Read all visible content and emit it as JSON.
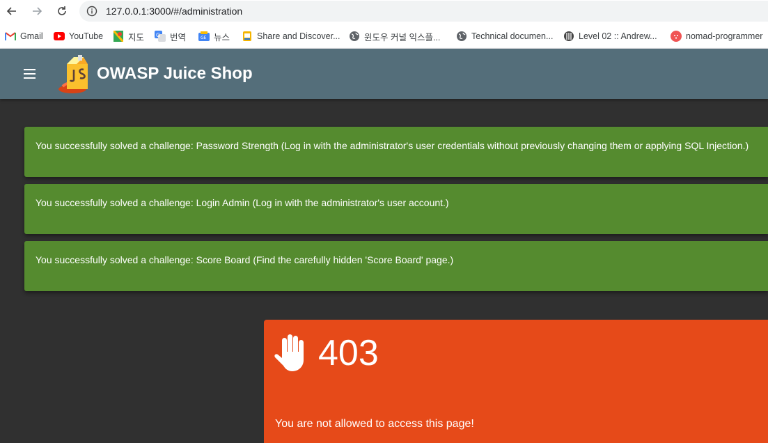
{
  "browser": {
    "url": "127.0.0.1:3000/#/administration",
    "bookmarks": [
      {
        "label": "Gmail",
        "icon": "gmail-icon"
      },
      {
        "label": "YouTube",
        "icon": "youtube-icon"
      },
      {
        "label": "지도",
        "icon": "maps-icon"
      },
      {
        "label": "번역",
        "icon": "translate-icon"
      },
      {
        "label": "뉴스",
        "icon": "news-icon"
      },
      {
        "label": "Share and Discover...",
        "icon": "share-icon"
      },
      {
        "label": "윈도우 커널 익스플...",
        "icon": "globe-icon"
      },
      {
        "label": "Technical documen...",
        "icon": "globe-icon"
      },
      {
        "label": "Level 02 :: Andrew...",
        "icon": "level-icon"
      },
      {
        "label": "nomad-programmer",
        "icon": "nomad-icon"
      }
    ]
  },
  "app": {
    "title": "OWASP Juice Shop"
  },
  "notifications": [
    "You successfully solved a challenge: Password Strength (Log in with the administrator's user credentials without previously changing them or applying SQL Injection.)",
    "You successfully solved a challenge: Login Admin (Log in with the administrator's user account.)",
    "You successfully solved a challenge: Score Board (Find the carefully hidden 'Score Board' page.)"
  ],
  "error": {
    "code": "403",
    "message": "You are not allowed to access this page!"
  },
  "colors": {
    "toolbar": "#546e7a",
    "background": "#303030",
    "success": "#558b2f",
    "error": "#e64a19"
  }
}
